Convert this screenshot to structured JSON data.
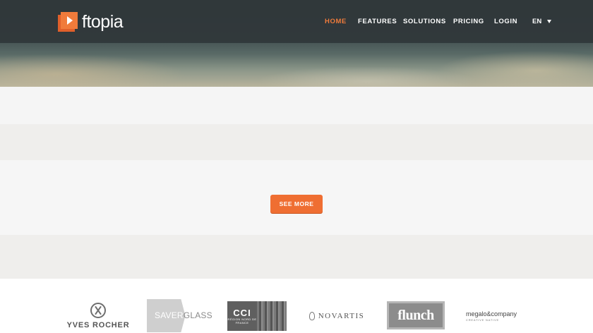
{
  "brand": {
    "name": "ftopia",
    "accent_color": "#f07b3b"
  },
  "nav": {
    "items": [
      {
        "label": "HOME",
        "active": true
      },
      {
        "label": "FEATURES",
        "active": false
      },
      {
        "label": "SOLUTIONS",
        "active": false
      },
      {
        "label": "PRICING",
        "active": false
      },
      {
        "label": "LOGIN",
        "active": false
      }
    ],
    "language": {
      "label": "EN",
      "icon": "chevron-down-icon"
    }
  },
  "main": {
    "see_more_label": "SEE MORE"
  },
  "clients": {
    "yves_rocher": "YVES ROCHER",
    "saverglass_a": "SAVER",
    "saverglass_b": "GLASS",
    "cci_big": "CCI",
    "cci_small": "RÉGION NORD DE FRANCE",
    "novartis": "NOVARTIS",
    "flunch": "flunch",
    "megalo": "megalo&company",
    "megalo_sub": "CREATIVE NATIVE"
  }
}
